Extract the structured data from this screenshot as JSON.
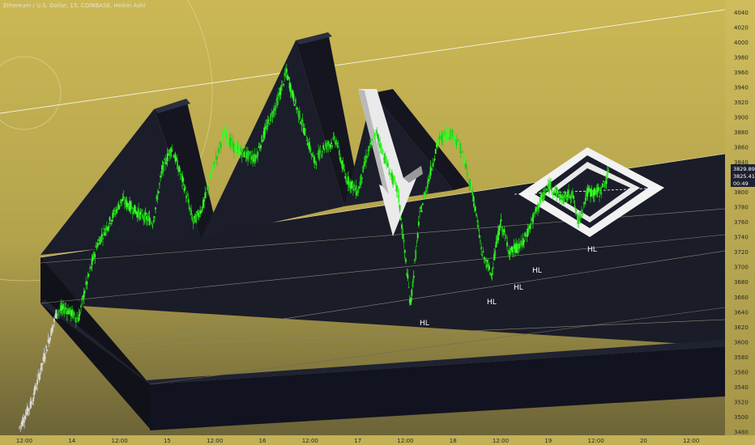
{
  "colors": {
    "background_top": "#c9b552",
    "background_bottom": "#7d7240",
    "axis_bg": "#c8b658",
    "plot_dark": "#1b1d2b",
    "candle_up": "#33ff22",
    "candle_down": "#1fcc17",
    "white_shape": "#e9e9e9",
    "badge_bg": "#1e2030"
  },
  "chart_data": {
    "type": "line",
    "title": "Ethereum / U.S. Dollar, 15, COINBASE, Heikin Ashi",
    "ylim": [
      3480,
      4050
    ],
    "y_ticks": [
      3480,
      3500,
      3520,
      3540,
      3560,
      3580,
      3600,
      3620,
      3640,
      3660,
      3680,
      3700,
      3720,
      3740,
      3760,
      3780,
      3800,
      3820,
      3840,
      3860,
      3880,
      3900,
      3920,
      3940,
      3960,
      3980,
      4000,
      4020,
      4040
    ],
    "x_ticks": [
      "12:00",
      "14",
      "12:00",
      "15",
      "12:00",
      "16",
      "12:00",
      "17",
      "12:00",
      "18",
      "12:00",
      "19",
      "12:00",
      "20",
      "12:00"
    ],
    "price_labels": [
      "3829.89",
      "3825.41",
      "00:49"
    ],
    "series": [
      {
        "points": [
          [
            0,
            3486
          ],
          [
            4,
            3520
          ],
          [
            8,
            3580
          ],
          [
            12,
            3640
          ],
          [
            15,
            3645
          ],
          [
            19,
            3630
          ],
          [
            21,
            3668
          ],
          [
            25,
            3730
          ],
          [
            29,
            3760
          ],
          [
            33,
            3790
          ],
          [
            36,
            3780
          ],
          [
            39,
            3770
          ],
          [
            43,
            3760
          ],
          [
            46,
            3830
          ],
          [
            49,
            3860
          ],
          [
            53,
            3810
          ],
          [
            56,
            3760
          ],
          [
            59,
            3780
          ],
          [
            63,
            3840
          ],
          [
            66,
            3880
          ],
          [
            69,
            3860
          ],
          [
            73,
            3850
          ],
          [
            76,
            3845
          ],
          [
            79,
            3880
          ],
          [
            83,
            3920
          ],
          [
            86,
            3960
          ],
          [
            88,
            3930
          ],
          [
            92,
            3880
          ],
          [
            95,
            3840
          ],
          [
            98,
            3860
          ],
          [
            102,
            3870
          ],
          [
            105,
            3820
          ],
          [
            109,
            3800
          ],
          [
            112,
            3850
          ],
          [
            115,
            3880
          ],
          [
            119,
            3830
          ],
          [
            122,
            3800
          ],
          [
            126,
            3650
          ],
          [
            129,
            3770
          ],
          [
            132,
            3820
          ],
          [
            135,
            3870
          ],
          [
            139,
            3880
          ],
          [
            142,
            3860
          ],
          [
            146,
            3800
          ],
          [
            149,
            3720
          ],
          [
            152,
            3690
          ],
          [
            155,
            3760
          ],
          [
            158,
            3720
          ],
          [
            162,
            3730
          ],
          [
            165,
            3760
          ],
          [
            168,
            3790
          ],
          [
            171,
            3810
          ],
          [
            175,
            3790
          ],
          [
            178,
            3800
          ],
          [
            180,
            3760
          ],
          [
            183,
            3800
          ],
          [
            187,
            3800
          ],
          [
            190,
            3825
          ]
        ]
      }
    ],
    "annotations": [
      "HL",
      "HL",
      "HL",
      "HL",
      "HL"
    ]
  }
}
